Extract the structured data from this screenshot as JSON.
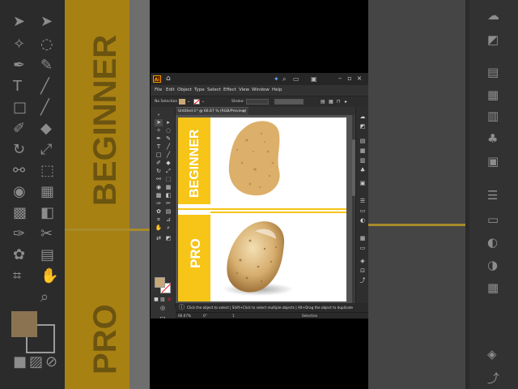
{
  "background": {
    "left_text_top": "BEGINNER",
    "left_text_bottom": "PRO",
    "colors": {
      "yellow": "#f6c518",
      "dark": "#2b2b2b"
    }
  },
  "app": {
    "logo": "Ai",
    "menu": [
      "File",
      "Edit",
      "Object",
      "Type",
      "Select",
      "Effect",
      "View",
      "Window",
      "Help"
    ],
    "control_bar": {
      "selection_label": "No Selection",
      "stroke_label": "Stroke:"
    },
    "document_tab": {
      "title": "Untitled-1* @ 66.67 % (RGB/Preview)",
      "close": "×"
    },
    "artboard": {
      "top_label": "BEGINNER",
      "bottom_label": "PRO",
      "top_image": "flat potato",
      "bottom_image": "shaded potato"
    },
    "status": {
      "hint": "Click the object to select  |  Shift+Click to select multiple objects  |  Alt+Drag the object to duplicate"
    },
    "bottom_bar": {
      "zoom": "66.67%",
      "rotate": "0°",
      "artboard_num": "1",
      "tool_name": "Selection"
    },
    "swatches": {
      "fill": "#c9a877",
      "stroke": "none"
    }
  }
}
